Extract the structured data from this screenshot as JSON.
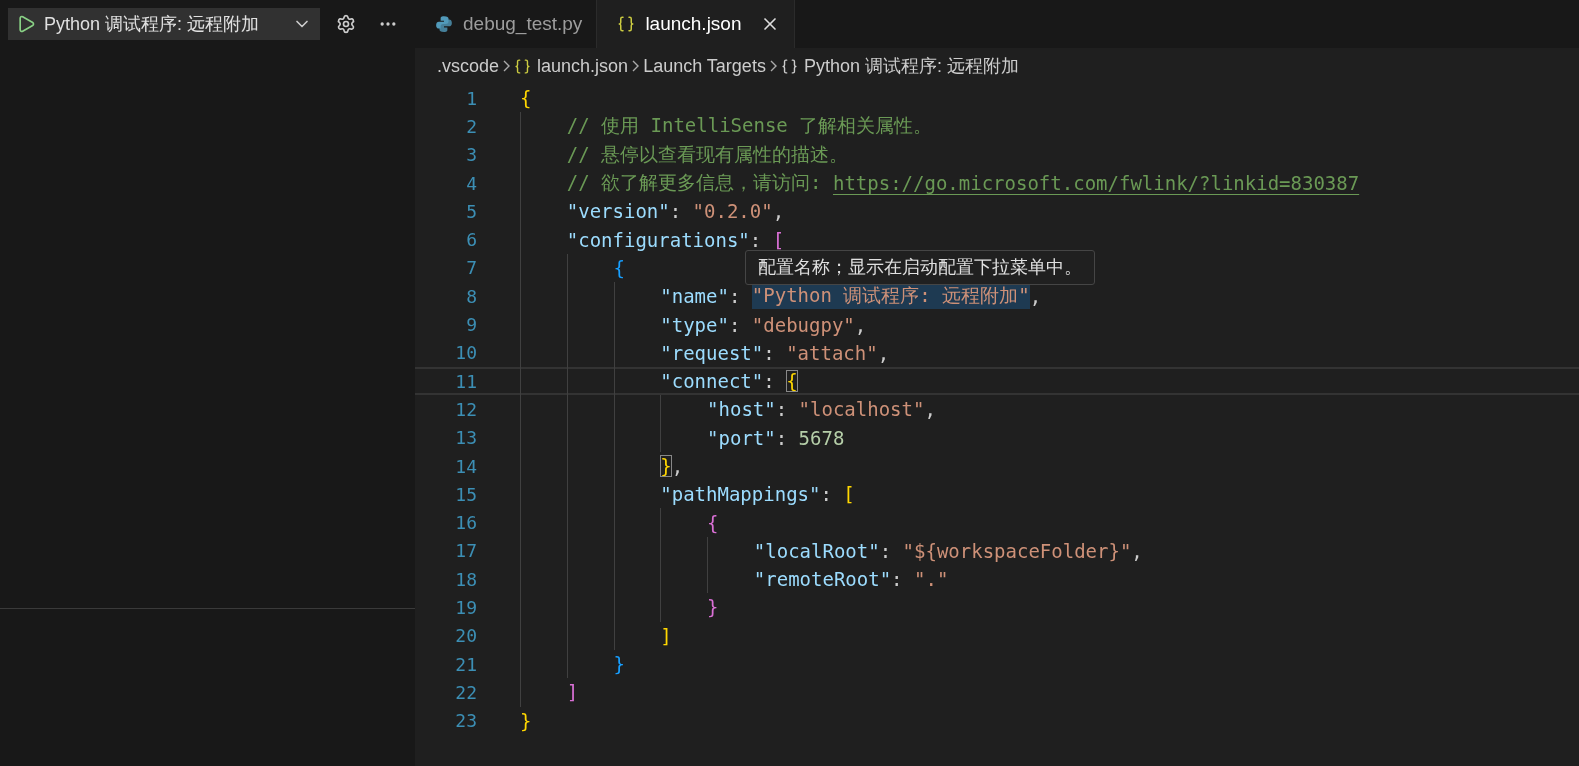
{
  "run_bar": {
    "configuration": "Python 调试程序: 远程附加"
  },
  "tabs": [
    {
      "label": "debug_test.py",
      "kind": "python",
      "selected": false
    },
    {
      "label": "launch.json",
      "kind": "json",
      "selected": true
    }
  ],
  "breadcrumbs": [
    {
      "label": ".vscode",
      "kind": "folder"
    },
    {
      "label": "launch.json",
      "kind": "json"
    },
    {
      "label": "Launch Targets",
      "kind": "plain"
    },
    {
      "label": "Python 调试程序: 远程附加",
      "kind": "object"
    }
  ],
  "hover_tooltip": "配置名称；显示在启动配置下拉菜单中。",
  "lines": [
    {
      "number": "1",
      "tokens": [
        {
          "kind": "bracket",
          "text": "{",
          "color": "#ffd700"
        }
      ]
    },
    {
      "number": "2",
      "tokens": [
        {
          "kind": "comment",
          "text": "    // 使用 IntelliSense 了解相关属性。"
        }
      ]
    },
    {
      "number": "3",
      "tokens": [
        {
          "kind": "comment",
          "text": "    // 悬停以查看现有属性的描述。"
        }
      ]
    },
    {
      "number": "4",
      "tokens": [
        {
          "kind": "comment",
          "text": "    // 欲了解更多信息，请访问: "
        },
        {
          "kind": "link",
          "text": "https://go.microsoft.com/fwlink/?linkid=830387"
        }
      ]
    },
    {
      "number": "5",
      "tokens": [
        {
          "kind": "key",
          "text": "    \"version\""
        },
        {
          "kind": "punct",
          "text": ": "
        },
        {
          "kind": "string",
          "text": "\"0.2.0\""
        },
        {
          "kind": "punct",
          "text": ","
        }
      ]
    },
    {
      "number": "6",
      "tokens": [
        {
          "kind": "key",
          "text": "    \"configurations\""
        },
        {
          "kind": "punct",
          "text": ": "
        },
        {
          "kind": "bracket",
          "text": "[",
          "color": "#da70d6"
        }
      ]
    },
    {
      "number": "7",
      "tokens": [
        {
          "kind": "bracket",
          "text": "        {",
          "color": "#179fff"
        }
      ]
    },
    {
      "number": "8",
      "tokens": [
        {
          "kind": "key",
          "text": "            \"name\""
        },
        {
          "kind": "punct",
          "text": ": "
        },
        {
          "kind": "string",
          "text": "\"Python 调试程序: 远程附加\"",
          "hovered": true
        },
        {
          "kind": "punct",
          "text": ","
        }
      ]
    },
    {
      "number": "9",
      "tokens": [
        {
          "kind": "key",
          "text": "            \"type\""
        },
        {
          "kind": "punct",
          "text": ": "
        },
        {
          "kind": "string",
          "text": "\"debugpy\""
        },
        {
          "kind": "punct",
          "text": ","
        }
      ]
    },
    {
      "number": "10",
      "tokens": [
        {
          "kind": "key",
          "text": "            \"request\""
        },
        {
          "kind": "punct",
          "text": ": "
        },
        {
          "kind": "string",
          "text": "\"attach\""
        },
        {
          "kind": "punct",
          "text": ","
        }
      ]
    },
    {
      "number": "11",
      "current": true,
      "tokens": [
        {
          "kind": "key",
          "text": "            \"connect\""
        },
        {
          "kind": "punct",
          "text": ": "
        },
        {
          "kind": "bracket",
          "text": "{",
          "color": "#ffd700",
          "matched": true
        }
      ]
    },
    {
      "number": "12",
      "tokens": [
        {
          "kind": "key",
          "text": "                \"host\""
        },
        {
          "kind": "punct",
          "text": ": "
        },
        {
          "kind": "string",
          "text": "\"localhost\""
        },
        {
          "kind": "punct",
          "text": ","
        }
      ]
    },
    {
      "number": "13",
      "tokens": [
        {
          "kind": "key",
          "text": "                \"port\""
        },
        {
          "kind": "punct",
          "text": ": "
        },
        {
          "kind": "number",
          "text": "5678"
        }
      ]
    },
    {
      "number": "14",
      "tokens": [
        {
          "kind": "bracket",
          "text": "            }",
          "color": "#ffd700",
          "matched": true
        },
        {
          "kind": "punct",
          "text": ","
        }
      ]
    },
    {
      "number": "15",
      "tokens": [
        {
          "kind": "key",
          "text": "            \"pathMappings\""
        },
        {
          "kind": "punct",
          "text": ": "
        },
        {
          "kind": "bracket",
          "text": "[",
          "color": "#ffd700"
        }
      ]
    },
    {
      "number": "16",
      "tokens": [
        {
          "kind": "bracket",
          "text": "                {",
          "color": "#da70d6"
        }
      ]
    },
    {
      "number": "17",
      "tokens": [
        {
          "kind": "key",
          "text": "                    \"localRoot\""
        },
        {
          "kind": "punct",
          "text": ": "
        },
        {
          "kind": "string",
          "text": "\"${workspaceFolder}\""
        },
        {
          "kind": "punct",
          "text": ","
        }
      ]
    },
    {
      "number": "18",
      "tokens": [
        {
          "kind": "key",
          "text": "                    \"remoteRoot\""
        },
        {
          "kind": "punct",
          "text": ": "
        },
        {
          "kind": "string",
          "text": "\".\""
        }
      ]
    },
    {
      "number": "19",
      "tokens": [
        {
          "kind": "bracket",
          "text": "                }",
          "color": "#da70d6"
        }
      ]
    },
    {
      "number": "20",
      "tokens": [
        {
          "kind": "bracket",
          "text": "            ]",
          "color": "#ffd700"
        }
      ]
    },
    {
      "number": "21",
      "tokens": [
        {
          "kind": "bracket",
          "text": "        }",
          "color": "#179fff"
        }
      ]
    },
    {
      "number": "22",
      "tokens": [
        {
          "kind": "bracket",
          "text": "    ]",
          "color": "#da70d6"
        }
      ]
    },
    {
      "number": "23",
      "tokens": [
        {
          "kind": "bracket",
          "text": "}",
          "color": "#ffd700"
        }
      ]
    }
  ]
}
